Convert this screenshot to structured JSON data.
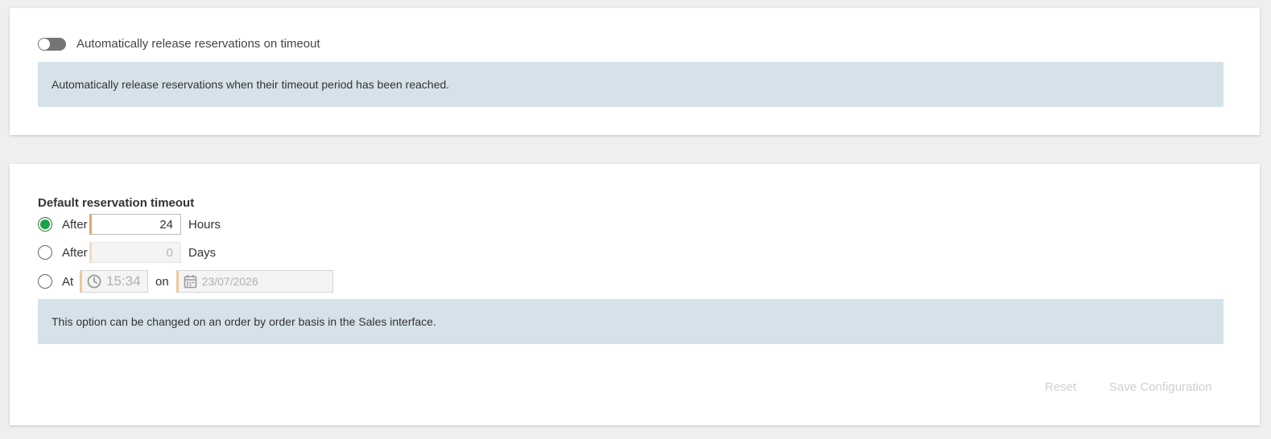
{
  "auto_release": {
    "toggle_label": "Automatically release reservations on timeout",
    "enabled": false,
    "info": "Automatically release reservations when their timeout period has been reached."
  },
  "timeout": {
    "title": "Default reservation timeout",
    "options": [
      {
        "label": "After",
        "value": "24",
        "unit": "Hours",
        "selected": true
      },
      {
        "label": "After",
        "value": "0",
        "unit": "Days",
        "selected": false
      },
      {
        "label": "At",
        "time": "15:34",
        "on_label": "on",
        "date": "23/07/2026",
        "selected": false
      }
    ],
    "info": "This option can be changed on an order by order basis in the Sales interface."
  },
  "actions": {
    "reset_label": "Reset",
    "save_label": "Save Configuration"
  },
  "colors": {
    "info_bg": "#d6e2e9",
    "radio_selected": "#1aa34a",
    "input_accent": "#e0a96d",
    "toggle_off": "#757575"
  },
  "icons": [
    "clock-icon",
    "calendar-icon"
  ]
}
